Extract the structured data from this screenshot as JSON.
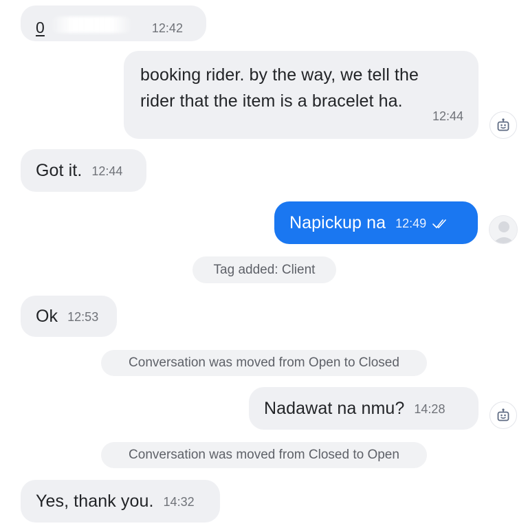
{
  "messages": [
    {
      "id": "m1",
      "text": "0",
      "time": "12:42"
    },
    {
      "id": "m2",
      "text_line1": "booking rider. by the way, we tell the",
      "text_line2": "rider that the item is a bracelet ha.",
      "time": "12:44",
      "sender_icon": "bot-icon"
    },
    {
      "id": "m3",
      "text": "Got it.",
      "time": "12:44"
    },
    {
      "id": "m4",
      "text": "Napickup na",
      "time": "12:49",
      "status_icon": "double-check-icon",
      "sender_icon": "avatar"
    },
    {
      "id": "m5",
      "text": "Ok",
      "time": "12:53"
    },
    {
      "id": "m6",
      "text": "Nadawat na nmu?",
      "time": "14:28",
      "sender_icon": "bot-icon"
    },
    {
      "id": "m7",
      "text": "Yes, thank you.",
      "time": "14:32"
    }
  ],
  "system_events": [
    {
      "id": "s1",
      "text": "Tag added: Client"
    },
    {
      "id": "s2",
      "text": "Conversation was moved from Open to Closed"
    },
    {
      "id": "s3",
      "text": "Conversation was moved from Closed to Open"
    }
  ],
  "colors": {
    "incoming_bubble": "#eff0f3",
    "outgoing_bubble": "#eff0f3",
    "outgoing_blue": "#1a77f1",
    "timestamp": "#6f7278",
    "system_text": "#5e6168"
  }
}
